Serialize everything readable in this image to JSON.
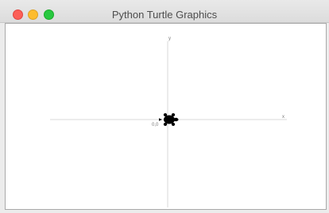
{
  "window": {
    "title": "Python Turtle Graphics"
  },
  "canvas": {
    "x_label": "x",
    "y_label": "y",
    "origin_label": "0,0"
  },
  "colors": {
    "close": "#fc5f57",
    "minimize": "#fdbc2e",
    "maximize": "#28c840",
    "axis": "#d8d8d8",
    "turtle": "#000000"
  },
  "icons": {
    "turtle": "turtle-cursor-icon"
  }
}
